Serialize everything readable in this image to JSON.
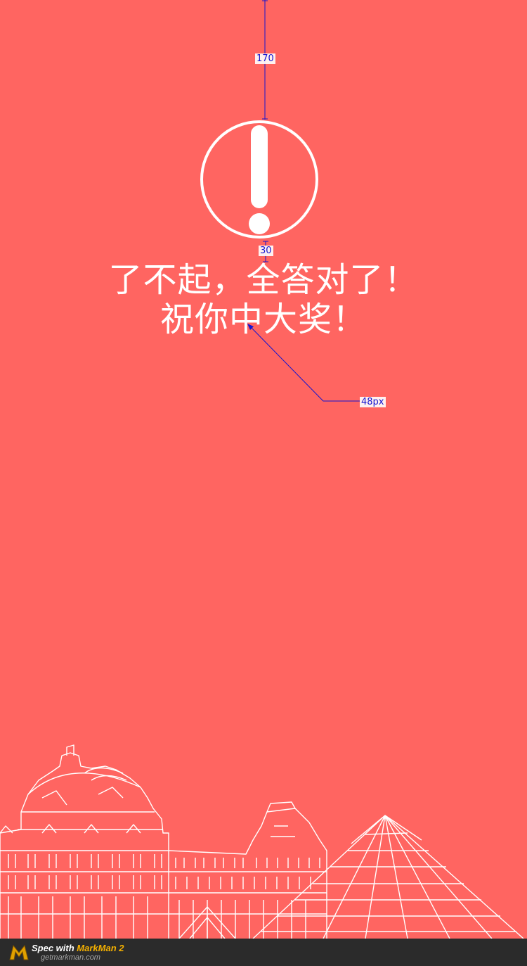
{
  "result": {
    "line1": "了不起，全答对了！",
    "line2": "祝你中大奖！"
  },
  "spec": {
    "top_distance": "170",
    "gap_distance": "30",
    "font_size": "48px"
  },
  "footer": {
    "brand_prefix": "Spec with ",
    "brand_name": "MarkMan 2",
    "site": "getmarkman.com"
  },
  "colors": {
    "background": "#ff6561",
    "foreground": "#ffffff",
    "spec_annotation": "#1515d0",
    "footer_bg": "#2b2b2b",
    "brand_accent": "#f4b000"
  },
  "icons": {
    "alert": "exclamation-circle-icon",
    "illustration": "louvre-skyline-illustration",
    "logo": "markman-logo-icon"
  }
}
